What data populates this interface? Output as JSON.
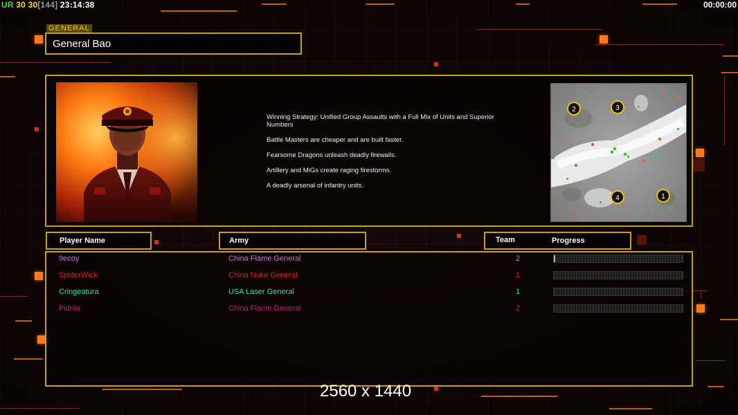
{
  "hud": {
    "label": "UR",
    "val1": "30",
    "val2": "30",
    "bracket": "[144]",
    "clock": "23:14:38",
    "timer": "00:00:00"
  },
  "general": {
    "tag": "GENERAL",
    "name": "General Bao",
    "description": [
      "Winning Strategy: Unified Group Assaults with a Full Mix of Units and Superior Numbers",
      "Battle Masters are cheaper and are built faster.",
      "Fearsome Dragons unleash deadly firewalls.",
      "Artillery and MiGs create raging firestorms.",
      "A deadly arsenal of infantry units."
    ]
  },
  "minimap": {
    "start_positions": [
      "2",
      "3",
      "4",
      "1"
    ]
  },
  "headers": {
    "player_name": "Player Name",
    "army": "Army",
    "team": "Team",
    "progress": "Progress"
  },
  "players": [
    {
      "name": "9ecoy",
      "army": "China Flame General",
      "team": "2",
      "color": "#d070e8",
      "progress": 0.01
    },
    {
      "name": "SpiderWick",
      "army": "China Nuke General",
      "team": "1",
      "color": "#e82020",
      "progress": 0
    },
    {
      "name": "Cringeatura",
      "army": "USA Laser General",
      "team": "1",
      "color": "#38e89c",
      "progress": 0
    },
    {
      "name": "Pidrila",
      "army": "China Flame General",
      "team": "2",
      "color": "#c8208c",
      "progress": 0
    }
  ],
  "resolution": "2560 x 1440",
  "colors": {
    "frame": "#c9a21a",
    "accent": "#ff7a14"
  }
}
